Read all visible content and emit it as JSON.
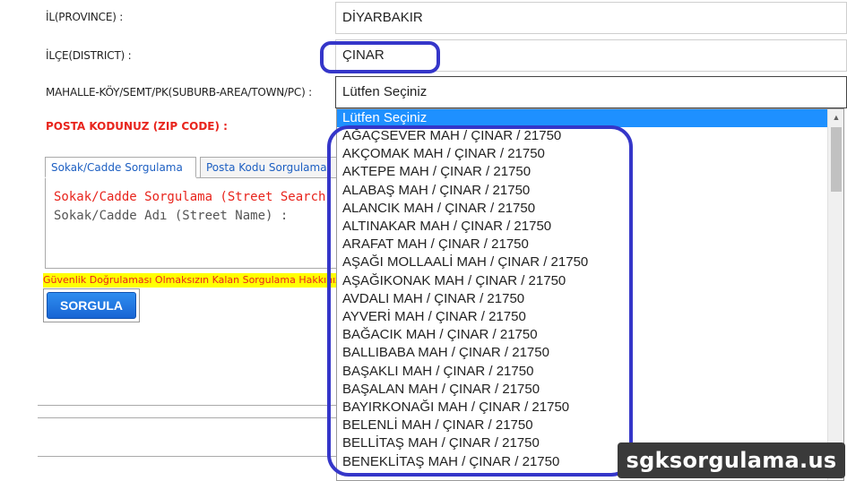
{
  "form": {
    "province_label": "İL(PROVINCE) :",
    "province_value": "DİYARBAKIR",
    "district_label": "İLÇE(DISTRICT) :",
    "district_value": "ÇINAR",
    "suburb_label": "MAHALLE-KÖY/SEMT/PK(SUBURB-AREA/TOWN/PC) :",
    "suburb_value": "Lütfen Seçiniz",
    "zip_label": "POSTA KODUNUZ (ZIP CODE) :"
  },
  "tabs": [
    {
      "label": "Sokak/Cadde Sorgulama"
    },
    {
      "label": "Posta Kodu Sorgulama"
    }
  ],
  "panel": {
    "title": "Sokak/Cadde Sorgulama (Street Search)",
    "sub": "Sokak/Cadde Adı (Street Name) :"
  },
  "warning": "Güvenlik Doğrulaması Olmaksızın Kalan Sorgulama Hakkınız",
  "query_button": "SORGULA",
  "dropdown": {
    "selected": "Lütfen Seçiniz",
    "options": [
      "AĞAÇSEVER MAH / ÇINAR / 21750",
      "AKÇOMAK MAH / ÇINAR / 21750",
      "AKTEPE MAH / ÇINAR / 21750",
      "ALABAŞ MAH / ÇINAR / 21750",
      "ALANCIK MAH / ÇINAR / 21750",
      "ALTINAKAR MAH / ÇINAR / 21750",
      "ARAFAT MAH / ÇINAR / 21750",
      "AŞAĞI MOLLAALİ MAH / ÇINAR / 21750",
      "AŞAĞIKONAK MAH / ÇINAR / 21750",
      "AVDALI MAH / ÇINAR / 21750",
      "AYVERİ MAH / ÇINAR / 21750",
      "BAĞACIK MAH / ÇINAR / 21750",
      "BALLIBABA MAH / ÇINAR / 21750",
      "BAŞAKLI MAH / ÇINAR / 21750",
      "BAŞALAN MAH / ÇINAR / 21750",
      "BAYIRKONAĞI MAH / ÇINAR / 21750",
      "BELENLİ MAH / ÇINAR / 21750",
      "BELLİTAŞ MAH / ÇINAR / 21750",
      "BENEKLİTAŞ MAH / ÇINAR / 21750"
    ]
  },
  "watermark": "sgksorgulama.us",
  "colors": {
    "accent": "#1e90ff",
    "highlight": "#3536c9",
    "error": "#e8241c",
    "warning_bg": "#ffff00"
  }
}
